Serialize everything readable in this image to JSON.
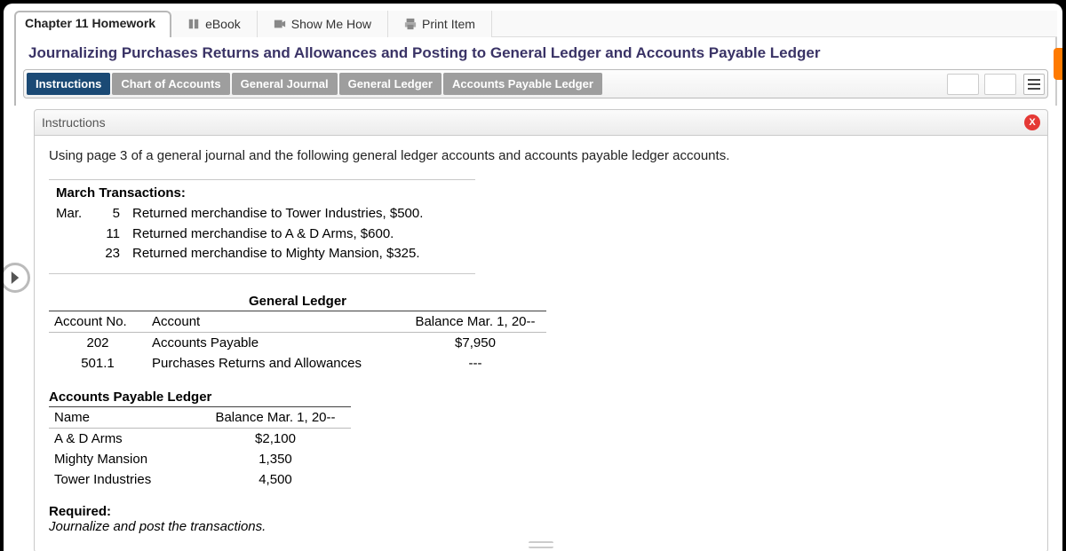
{
  "topbar": {
    "chapter": "Chapter 11 Homework",
    "ebook": "eBook",
    "show_me_how": "Show Me How",
    "print_item": "Print Item"
  },
  "subheading": "Journalizing Purchases Returns and Allowances and Posting to General Ledger and Accounts Payable Ledger",
  "tabs": {
    "instructions": "Instructions",
    "chart_of_accounts": "Chart of Accounts",
    "general_journal": "General Journal",
    "general_ledger": "General Ledger",
    "ap_ledger": "Accounts Payable Ledger"
  },
  "panel_title": "Instructions",
  "intro": "Using page 3 of a general journal and the following general ledger accounts and accounts payable ledger accounts.",
  "march": {
    "title": "March Transactions:",
    "month": "Mar.",
    "rows": [
      {
        "day": "5",
        "desc": "Returned merchandise to Tower Industries, $500."
      },
      {
        "day": "11",
        "desc": "Returned merchandise to A & D Arms, $600."
      },
      {
        "day": "23",
        "desc": "Returned merchandise to Mighty Mansion, $325."
      }
    ]
  },
  "gl": {
    "title": "General Ledger",
    "h1": "Account No.",
    "h2": "Account",
    "h3": "Balance Mar. 1, 20--",
    "rows": [
      {
        "no": "202",
        "name": "Accounts Payable",
        "bal": "$7,950"
      },
      {
        "no": "501.1",
        "name": "Purchases Returns and Allowances",
        "bal": "---"
      }
    ]
  },
  "ap": {
    "title": "Accounts Payable Ledger",
    "h1": "Name",
    "h2": "Balance Mar. 1, 20--",
    "rows": [
      {
        "name": "A & D Arms",
        "bal": "$2,100"
      },
      {
        "name": "Mighty Mansion",
        "bal": "1,350"
      },
      {
        "name": "Tower Industries",
        "bal": "4,500"
      }
    ]
  },
  "required": {
    "label": "Required:",
    "note": "Journalize and post the transactions."
  }
}
